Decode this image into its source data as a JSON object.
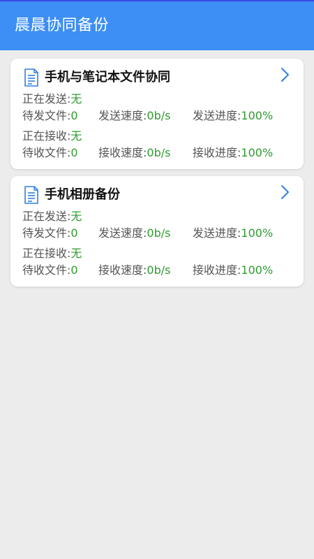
{
  "appbar": {
    "title": "晨晨协同备份"
  },
  "icons": {
    "doc": "document-icon",
    "chevron": "chevron-right-icon"
  },
  "colors": {
    "appbar": "#3d8ff5",
    "value_green": "#2d9b2d",
    "icon_blue": "#2f7fe0",
    "background": "#ececec"
  },
  "cards": [
    {
      "title": "手机与笔记本文件协同",
      "sending_label": "正在发送:",
      "sending_value": "无",
      "pending_send_label": "待发文件:",
      "pending_send_value": "0",
      "send_speed_label": "发送速度:",
      "send_speed_value": "0b/s",
      "send_progress_label": "发送进度:",
      "send_progress_value": "100%",
      "receiving_label": "正在接收:",
      "receiving_value": "无",
      "pending_recv_label": "待收文件:",
      "pending_recv_value": "0",
      "recv_speed_label": "接收速度:",
      "recv_speed_value": "0b/s",
      "recv_progress_label": "接收进度:",
      "recv_progress_value": "100%"
    },
    {
      "title": "手机相册备份",
      "sending_label": "正在发送:",
      "sending_value": "无",
      "pending_send_label": "待发文件:",
      "pending_send_value": "0",
      "send_speed_label": "发送速度:",
      "send_speed_value": "0b/s",
      "send_progress_label": "发送进度:",
      "send_progress_value": "100%",
      "receiving_label": "正在接收:",
      "receiving_value": "无",
      "pending_recv_label": "待收文件:",
      "pending_recv_value": "0",
      "recv_speed_label": "接收速度:",
      "recv_speed_value": "0b/s",
      "recv_progress_label": "接收进度:",
      "recv_progress_value": "100%"
    }
  ]
}
